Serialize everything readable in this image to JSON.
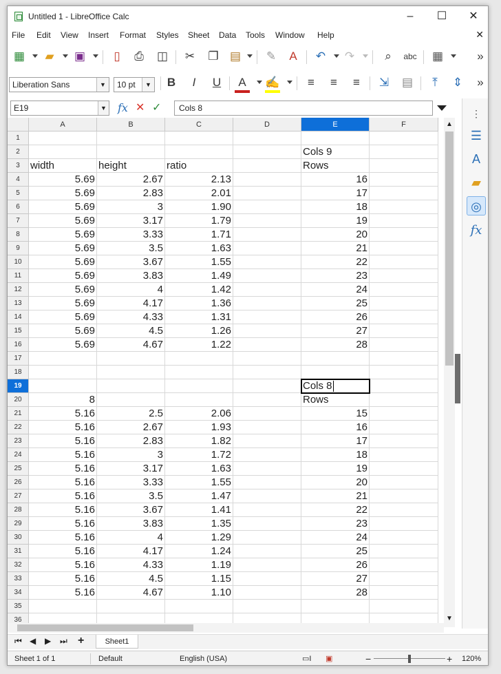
{
  "window": {
    "title": "Untitled 1 - LibreOffice Calc",
    "minimize": "–",
    "maximize": "☐",
    "close": "✕"
  },
  "menu": {
    "items": [
      "File",
      "Edit",
      "View",
      "Insert",
      "Format",
      "Styles",
      "Sheet",
      "Data",
      "Tools",
      "Window",
      "Help"
    ],
    "close_doc": "✕"
  },
  "format_toolbar": {
    "font_name": "Liberation Sans",
    "font_size": "10 pt",
    "bold": "B",
    "italic": "I",
    "underline": "U"
  },
  "formula_bar": {
    "cell_ref": "E19",
    "fx": "fx",
    "cancel": "✕",
    "accept": "✓",
    "content": "Cols 8"
  },
  "grid": {
    "columns": [
      "A",
      "B",
      "C",
      "D",
      "E",
      "F"
    ],
    "selected_column": "E",
    "selected_row": "19",
    "rows": [
      {
        "n": "1",
        "A": "",
        "B": "",
        "C": "",
        "E": ""
      },
      {
        "n": "2",
        "A": "",
        "B": "",
        "C": "",
        "E": "Cols 9"
      },
      {
        "n": "3",
        "A": "width",
        "B": "height",
        "C": "ratio",
        "E": "Rows"
      },
      {
        "n": "4",
        "A": "5.69",
        "B": "2.67",
        "C": "2.13",
        "E": "16"
      },
      {
        "n": "5",
        "A": "5.69",
        "B": "2.83",
        "C": "2.01",
        "E": "17"
      },
      {
        "n": "6",
        "A": "5.69",
        "B": "3",
        "C": "1.90",
        "E": "18"
      },
      {
        "n": "7",
        "A": "5.69",
        "B": "3.17",
        "C": "1.79",
        "E": "19"
      },
      {
        "n": "8",
        "A": "5.69",
        "B": "3.33",
        "C": "1.71",
        "E": "20"
      },
      {
        "n": "9",
        "A": "5.69",
        "B": "3.5",
        "C": "1.63",
        "E": "21"
      },
      {
        "n": "10",
        "A": "5.69",
        "B": "3.67",
        "C": "1.55",
        "E": "22"
      },
      {
        "n": "11",
        "A": "5.69",
        "B": "3.83",
        "C": "1.49",
        "E": "23"
      },
      {
        "n": "12",
        "A": "5.69",
        "B": "4",
        "C": "1.42",
        "E": "24"
      },
      {
        "n": "13",
        "A": "5.69",
        "B": "4.17",
        "C": "1.36",
        "E": "25"
      },
      {
        "n": "14",
        "A": "5.69",
        "B": "4.33",
        "C": "1.31",
        "E": "26"
      },
      {
        "n": "15",
        "A": "5.69",
        "B": "4.5",
        "C": "1.26",
        "E": "27"
      },
      {
        "n": "16",
        "A": "5.69",
        "B": "4.67",
        "C": "1.22",
        "E": "28"
      },
      {
        "n": "17",
        "A": "",
        "B": "",
        "C": "",
        "E": ""
      },
      {
        "n": "18",
        "A": "",
        "B": "",
        "C": "",
        "E": ""
      },
      {
        "n": "19",
        "A": "",
        "B": "",
        "C": "",
        "E": "Cols 8"
      },
      {
        "n": "20",
        "A": "8",
        "B": "",
        "C": "",
        "E": "Rows"
      },
      {
        "n": "21",
        "A": "5.16",
        "B": "2.5",
        "C": "2.06",
        "E": "15"
      },
      {
        "n": "22",
        "A": "5.16",
        "B": "2.67",
        "C": "1.93",
        "E": "16"
      },
      {
        "n": "23",
        "A": "5.16",
        "B": "2.83",
        "C": "1.82",
        "E": "17"
      },
      {
        "n": "24",
        "A": "5.16",
        "B": "3",
        "C": "1.72",
        "E": "18"
      },
      {
        "n": "25",
        "A": "5.16",
        "B": "3.17",
        "C": "1.63",
        "E": "19"
      },
      {
        "n": "26",
        "A": "5.16",
        "B": "3.33",
        "C": "1.55",
        "E": "20"
      },
      {
        "n": "27",
        "A": "5.16",
        "B": "3.5",
        "C": "1.47",
        "E": "21"
      },
      {
        "n": "28",
        "A": "5.16",
        "B": "3.67",
        "C": "1.41",
        "E": "22"
      },
      {
        "n": "29",
        "A": "5.16",
        "B": "3.83",
        "C": "1.35",
        "E": "23"
      },
      {
        "n": "30",
        "A": "5.16",
        "B": "4",
        "C": "1.29",
        "E": "24"
      },
      {
        "n": "31",
        "A": "5.16",
        "B": "4.17",
        "C": "1.24",
        "E": "25"
      },
      {
        "n": "32",
        "A": "5.16",
        "B": "4.33",
        "C": "1.19",
        "E": "26"
      },
      {
        "n": "33",
        "A": "5.16",
        "B": "4.5",
        "C": "1.15",
        "E": "27"
      },
      {
        "n": "34",
        "A": "5.16",
        "B": "4.67",
        "C": "1.10",
        "E": "28"
      },
      {
        "n": "35",
        "A": "",
        "B": "",
        "C": "",
        "E": ""
      },
      {
        "n": "36",
        "A": "",
        "B": "",
        "C": "",
        "E": ""
      }
    ]
  },
  "sheets": {
    "active": "Sheet1",
    "add": "+"
  },
  "status": {
    "sheet_info": "Sheet 1 of 1",
    "page_style": "Default",
    "language": "English (USA)",
    "zoom": "120%"
  },
  "colors": {
    "accent": "#0e6fd9",
    "header_bg": "#f0f0f0"
  }
}
